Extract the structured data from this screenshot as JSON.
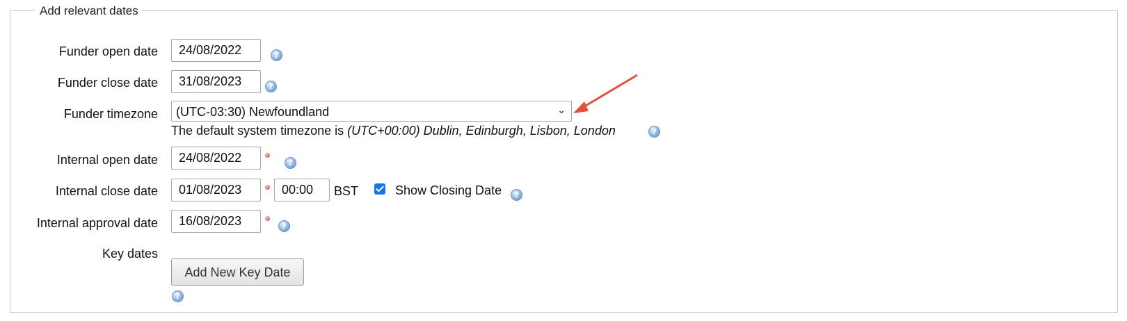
{
  "legend": "Add relevant dates",
  "fields": {
    "funder_open": {
      "label": "Funder open date",
      "value": "24/08/2022"
    },
    "funder_close": {
      "label": "Funder close date",
      "value": "31/08/2023"
    },
    "funder_timezone": {
      "label": "Funder timezone",
      "selected": "(UTC-03:30) Newfoundland",
      "note_prefix": "The default system timezone is ",
      "note_tz": "(UTC+00:00) Dublin, Edinburgh, Lisbon, London"
    },
    "internal_open": {
      "label": "Internal open date",
      "value": "24/08/2022"
    },
    "internal_close": {
      "label": "Internal close date",
      "value": "01/08/2023",
      "time": "00:00",
      "tz_suffix": "BST",
      "show_closing_label": "Show Closing Date",
      "show_closing_checked": true
    },
    "internal_approval": {
      "label": "Internal approval date",
      "value": "16/08/2023"
    },
    "key_dates": {
      "label": "Key dates",
      "button": "Add New Key Date"
    }
  },
  "icons": {
    "help": "help-icon",
    "required": "required-marker",
    "dropdown": "chevron-down-icon",
    "annotation": "red-arrow"
  },
  "colors": {
    "required": "#e34b4b",
    "checkbox": "#1a73e8",
    "annotation_arrow": "#e0523e"
  }
}
